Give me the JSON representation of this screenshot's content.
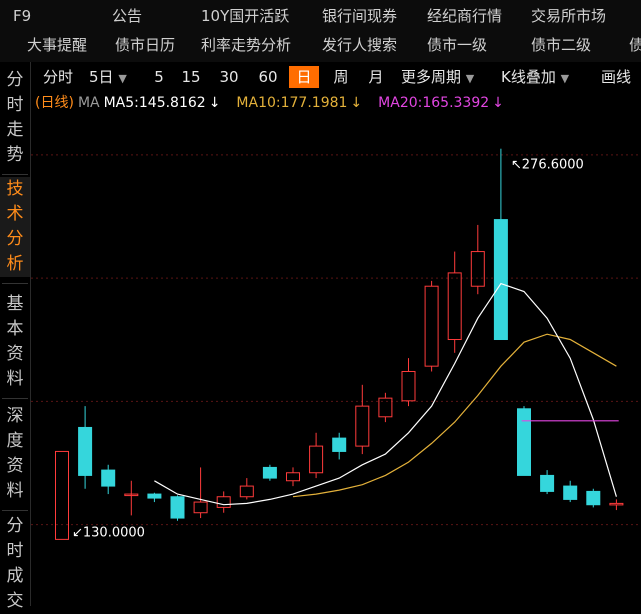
{
  "nav": {
    "row1": [
      "F9",
      "公告",
      "10Y国开活跃",
      "银行间现券",
      "经纪商行情",
      "交易所市场"
    ],
    "row2": [
      "大事提醒",
      "债市日历",
      "利率走势分析",
      "发行人搜索",
      "债市一级",
      "债市二级",
      "债"
    ]
  },
  "sidebar": {
    "tabs": [
      "分\n时\n走\n势",
      "技\n术\n分\n析",
      "基\n本\n资\n料",
      "深\n度\n资\n料",
      "分\n时\n成\n交"
    ]
  },
  "toolbar": {
    "fenshi": "分时",
    "fiveday": "5日",
    "p5": "5",
    "p15": "15",
    "p30": "30",
    "p60": "60",
    "day": "日",
    "week": "周",
    "month": "月",
    "more": "更多周期",
    "overlay": "K线叠加",
    "draw": "画线"
  },
  "indicator": {
    "period": "(日线)",
    "ma": "MA",
    "ma5": "MA5:145.8162",
    "ma10": "MA10:177.1981",
    "ma20": "MA20:165.3392",
    "arrow": "↓"
  },
  "colors": {
    "up": "#ff3b3b",
    "down": "#35d6dc",
    "ma5": "#ffffff",
    "ma10": "#e3b13a",
    "ma20": "#e246e2",
    "grid": "#5a1414",
    "active": "#ff6d00"
  },
  "chart_data": {
    "type": "candlestick",
    "ylim": [
      105,
      290
    ],
    "candles": [
      {
        "open": 130.0,
        "close": 163.0,
        "high": 163.0,
        "low": 130.0
      },
      {
        "open": 172.0,
        "close": 154.0,
        "high": 180.0,
        "low": 149.0
      },
      {
        "open": 156.0,
        "close": 150.0,
        "high": 158.0,
        "low": 147.0
      },
      {
        "open": 147.0,
        "close": 147.0,
        "high": 152.0,
        "low": 139.0
      },
      {
        "open": 147.0,
        "close": 145.5,
        "high": 147.5,
        "low": 144.0
      },
      {
        "open": 146.0,
        "close": 138.0,
        "high": 146.5,
        "low": 137.0
      },
      {
        "open": 140.0,
        "close": 144.0,
        "high": 157.0,
        "low": 138.0
      },
      {
        "open": 142.0,
        "close": 146.0,
        "high": 148.0,
        "low": 140.0
      },
      {
        "open": 146.0,
        "close": 150.0,
        "high": 153.0,
        "low": 145.0
      },
      {
        "open": 157.0,
        "close": 153.0,
        "high": 158.0,
        "low": 152.0
      },
      {
        "open": 152.0,
        "close": 155.0,
        "high": 157.0,
        "low": 150.0
      },
      {
        "open": 155.0,
        "close": 165.0,
        "high": 170.0,
        "low": 153.0
      },
      {
        "open": 168.0,
        "close": 163.0,
        "high": 170.0,
        "low": 160.0
      },
      {
        "open": 165.0,
        "close": 180.0,
        "high": 188.0,
        "low": 162.0
      },
      {
        "open": 176.0,
        "close": 183.0,
        "high": 185.0,
        "low": 174.0
      },
      {
        "open": 182.0,
        "close": 193.0,
        "high": 198.0,
        "low": 180.0
      },
      {
        "open": 195.0,
        "close": 225.0,
        "high": 227.0,
        "low": 193.0
      },
      {
        "open": 205.0,
        "close": 230.0,
        "high": 238.0,
        "low": 200.0
      },
      {
        "open": 225.0,
        "close": 238.0,
        "high": 248.0,
        "low": 222.0
      },
      {
        "open": 250.0,
        "close": 205.0,
        "high": 276.6,
        "low": 205.0
      },
      {
        "open": 179.0,
        "close": 154.0,
        "high": 180.0,
        "low": 154.0
      },
      {
        "open": 154.0,
        "close": 148.0,
        "high": 156.0,
        "low": 147.0
      },
      {
        "open": 150.0,
        "close": 145.0,
        "high": 152.0,
        "low": 144.0
      },
      {
        "open": 148.0,
        "close": 143.0,
        "high": 149.0,
        "low": 142.0
      },
      {
        "open": 143.0,
        "close": 143.5,
        "high": 145.0,
        "low": 141.0
      }
    ],
    "ma5": [
      null,
      null,
      null,
      null,
      152.0,
      147.0,
      145.0,
      143.0,
      143.5,
      145.0,
      147.0,
      150.0,
      153.0,
      158.0,
      162.0,
      170.0,
      180.0,
      196.0,
      213.0,
      226.0,
      223.0,
      213.0,
      198.0,
      175.0,
      146.0
    ],
    "ma10": [
      null,
      null,
      null,
      null,
      null,
      null,
      null,
      null,
      null,
      null,
      146.0,
      147.0,
      148.5,
      150.5,
      154.0,
      159.0,
      166.0,
      174.0,
      184.0,
      195.0,
      204.0,
      207.0,
      205.0,
      200.0,
      195.0
    ],
    "ma20": {
      "from": 19.9,
      "to": 24.1,
      "value": 174.5
    },
    "annotations": [
      {
        "candle": 19,
        "price": 276.6,
        "text": "276.6000",
        "dir": "up"
      },
      {
        "candle": 0,
        "price": 130.0,
        "text": "130.0000",
        "dir": "down"
      }
    ]
  }
}
